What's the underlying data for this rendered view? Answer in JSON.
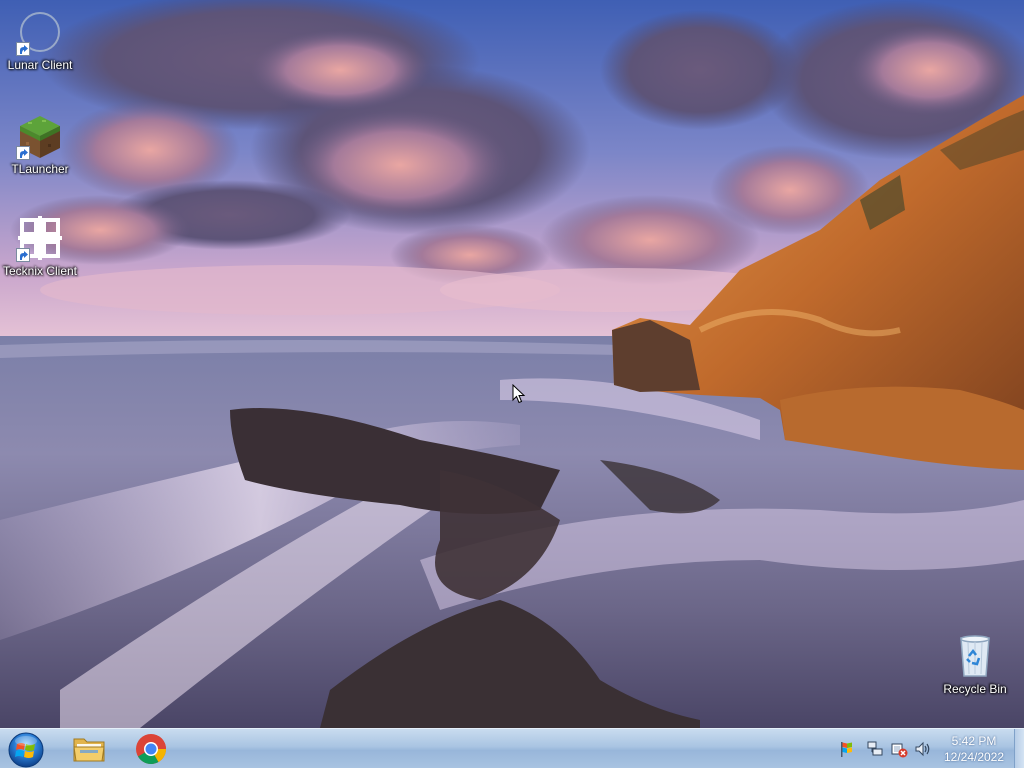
{
  "desktop": {
    "icons": [
      {
        "label": "Lunar Client",
        "icon": "lunar-client-icon"
      },
      {
        "label": "TLauncher",
        "icon": "grass-block-icon"
      },
      {
        "label": "Tecknix Client",
        "icon": "tecknix-logo-icon"
      },
      {
        "label": "Recycle Bin",
        "icon": "recycle-bin-icon"
      }
    ]
  },
  "taskbar": {
    "pinned": [
      {
        "name": "Windows Explorer",
        "icon": "folder-icon"
      },
      {
        "name": "Google Chrome",
        "icon": "chrome-icon"
      }
    ],
    "tray": {
      "icons": [
        "action-center-flag-icon",
        "network-icon",
        "power-disconnected-icon",
        "volume-icon"
      ],
      "time": "5:42 PM",
      "date": "12/24/2022"
    }
  },
  "colors": {
    "taskbar_top": "#c9dcef",
    "taskbar_bottom": "#98b6da",
    "sky": "#4a66b8",
    "cliff": "#d9813a"
  }
}
